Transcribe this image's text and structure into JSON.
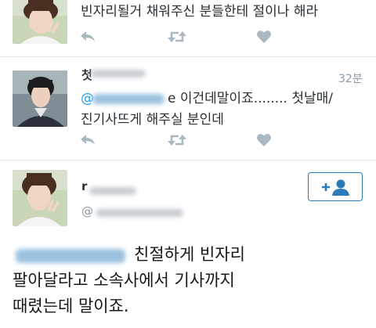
{
  "tweets": [
    {
      "text": "빈자리될거 채워주신 분들한테 절이나 해라",
      "actions": {
        "reply_icon": "reply-icon",
        "retweet_icon": "retweet-icon",
        "like_icon": "heart-icon"
      }
    },
    {
      "name_partial": "첫",
      "timestamp": "32분",
      "line1_prefix": "@",
      "line1_partial": "e 이건데말이죠........ 첫날매/",
      "line2": "진기사뜨게 해주실 분인데",
      "actions": {
        "reply_icon": "reply-icon",
        "retweet_icon": "retweet-icon",
        "like_icon": "heart-icon"
      }
    }
  ],
  "detail": {
    "name_partial": "r",
    "handle_prefix": "@",
    "follow_icon": "add-user-icon",
    "body_line1": "친절하게 빈자리",
    "body_line2": "팔아달라고 소속사에서 기사까지",
    "body_line3": "때렸는데 말이죠."
  },
  "colors": {
    "accent": "#1da1f2",
    "follow_blue": "#2b7bb9",
    "icon_gray": "#aab8c2",
    "divider": "#e1e8ed"
  }
}
